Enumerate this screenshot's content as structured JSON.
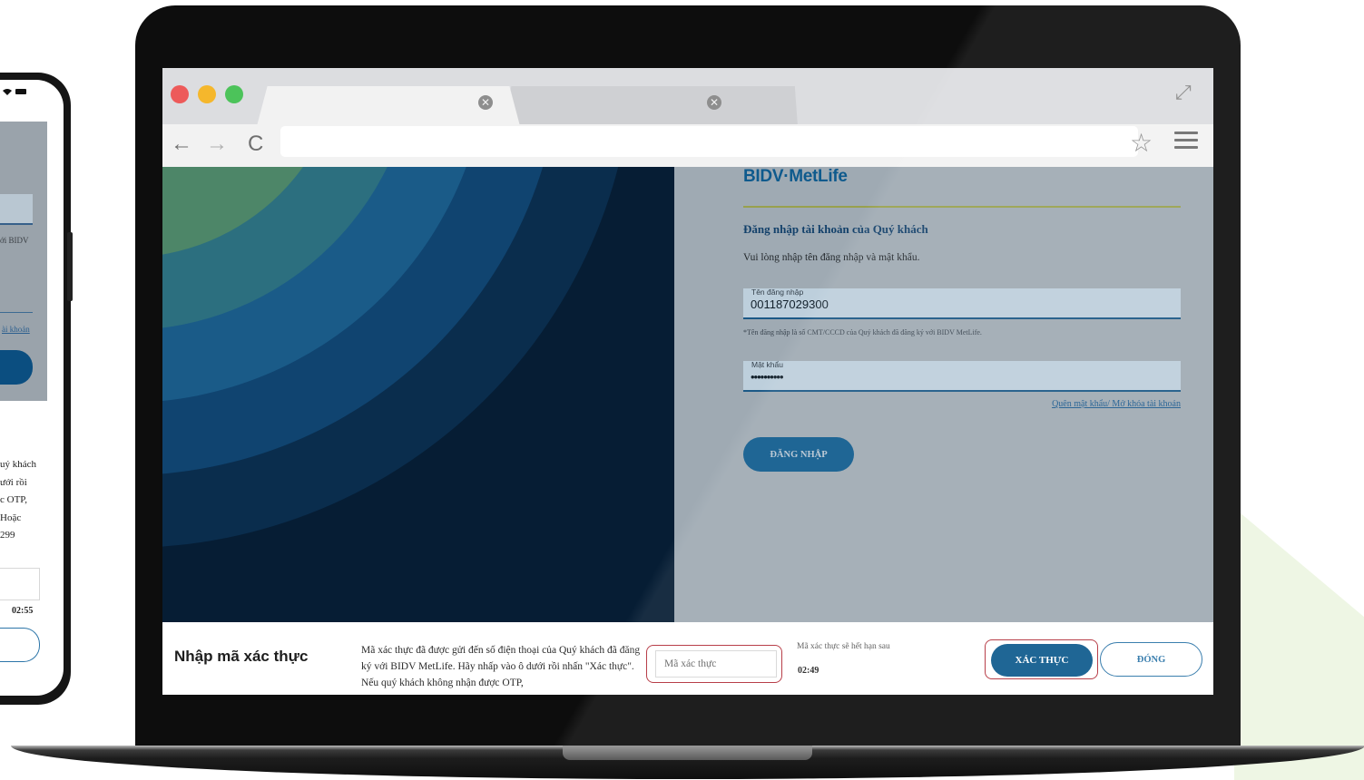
{
  "phone": {
    "text_fragments": [
      "ới BIDV",
      "ài khoản"
    ],
    "otp_lines": [
      "uý khách",
      "ưới rồi",
      "c OTP,",
      "Hoặc",
      "299"
    ],
    "timer": "02:55"
  },
  "browser": {
    "tab_close_glyph": "✕",
    "nav": {
      "back": "←",
      "forward": "→",
      "reload": "C"
    },
    "star_glyph": "☆",
    "expand_glyph": "⤢"
  },
  "login": {
    "logo": "BIDV·MetLife",
    "title": "Đăng nhập tài khoản của Quý khách",
    "subtitle": "Vui lòng nhập tên đăng nhập và mật khẩu.",
    "username_label": "Tên đăng nhập",
    "username_value": "001187029300",
    "hint": "*Tên đăng nhập là số CMT/CCCD của Quý khách đã đăng ký với BIDV MetLife.",
    "password_label": "Mật khẩu",
    "password_value": "••••••••••",
    "forgot_link": "Quên mật khẩu/ Mở khóa tài khoản",
    "login_button": "ĐĂNG NHẬP"
  },
  "otp": {
    "title": "Nhập mã xác thực",
    "description": "Mã xác thực đã được gửi đến số điện thoại của Quý khách đã đăng ký với BIDV MetLife. Hãy nhấp vào ô dưới rồi nhấn \"Xác thực\". Nếu quý khách không nhận được OTP,",
    "input_placeholder": "Mã xác thực",
    "expire_label": "Mã xác thực sẽ hết hạn sau",
    "expire_time": "02:49",
    "verify_button": "XÁC THỰC",
    "close_button": "ĐÓNG"
  },
  "colors": {
    "brand_blue": "#0e5a8d",
    "highlight_red": "#b3303b",
    "accent_olive": "#98a14d"
  }
}
